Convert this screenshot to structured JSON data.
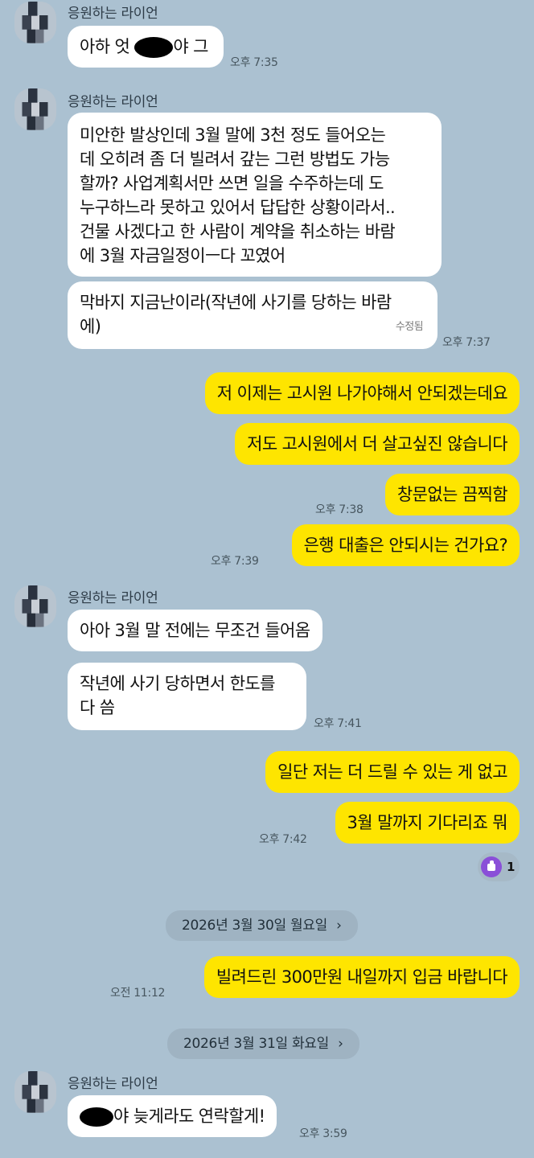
{
  "sender": "응원하는 라이언",
  "g1": {
    "m1_pre": "아하 엇 ",
    "m1_post": "야 그",
    "time": "오후 7:35"
  },
  "g2": {
    "m1": [
      "미안한 발상인데 3월 말에 3천 정도 들어오는",
      "데 오히려 좀 더 빌려서 갚는 그런 방법도 가능",
      "할까? 사업계획서만 쓰면 일을 수주하는데 도",
      "누구하느라 못하고 있어서 답답한 상황이라서..",
      "건물 사겠다고 한 사람이 계약을 취소하는 바람",
      "에 3월 자금일정이ㅡ다 꼬였어"
    ],
    "m2": [
      "막바지 지금난이라(작년에 사기를 당하는 바람",
      "에)"
    ],
    "edited": "수정됨",
    "time": "오후 7:37"
  },
  "me1": {
    "m1": "저 이제는 고시원 나가야해서 안되겠는데요",
    "m2": "저도 고시원에서 더 살고싶진 않습니다",
    "m3": "창문없는 끔찍함",
    "time1": "오후 7:38",
    "m4": "은행 대출은 안되시는 건가요?",
    "time2": "오후 7:39"
  },
  "g3": {
    "m1": "아아 3월 말 전에는 무조건 들어옴",
    "m2": [
      "작년에 사기 당하면서 한도를",
      "다 씀"
    ],
    "time": "오후 7:41"
  },
  "me2": {
    "m1": "일단 저는 더 드릴 수 있는 게 없고",
    "m2": "3월 말까지 기다리죠 뭐",
    "time": "오후 7:42",
    "reaction_icon": "thumbs-up-icon",
    "reaction_count": "1"
  },
  "date1": "2026년 3월 30일 월요일",
  "me3": {
    "m1": "빌려드린 300만원 내일까지 입금 바랍니다",
    "time": "오전 11:12"
  },
  "date2": "2026년 3월 31일 화요일",
  "g4": {
    "m1_post": "야 늦게라도 연락할게!",
    "time": "오후 3:59"
  },
  "colors": {
    "background": "#abc1d1",
    "my_bubble": "#fee500",
    "their_bubble": "#ffffff",
    "reaction": "#8a4fd8"
  }
}
